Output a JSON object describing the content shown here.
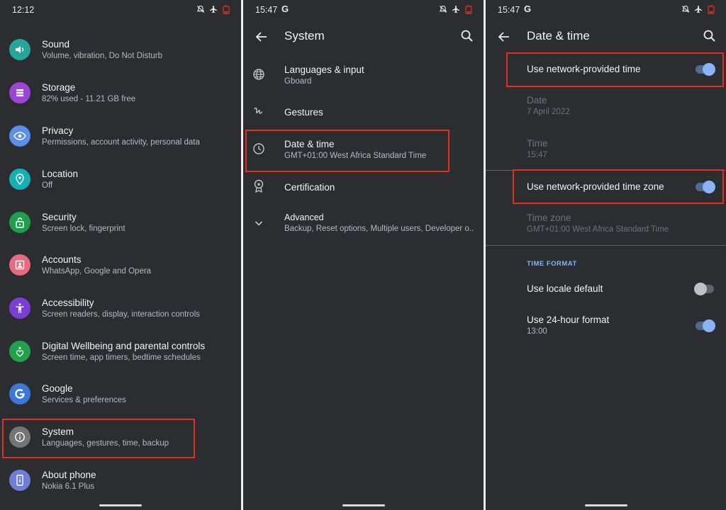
{
  "panel1": {
    "status_time": "12:12",
    "items": [
      {
        "title": "Sound",
        "subtitle": "Volume, vibration, Do Not Disturb",
        "icon": "sound-icon",
        "color": "#26a69a"
      },
      {
        "title": "Storage",
        "subtitle": "82% used - 11.21 GB free",
        "icon": "storage-icon",
        "color": "#9c45d6"
      },
      {
        "title": "Privacy",
        "subtitle": "Permissions, account activity, personal data",
        "icon": "privacy-icon",
        "color": "#5b8fe8"
      },
      {
        "title": "Location",
        "subtitle": "Off",
        "icon": "location-icon",
        "color": "#14b1b4"
      },
      {
        "title": "Security",
        "subtitle": "Screen lock, fingerprint",
        "icon": "security-icon",
        "color": "#1e9e4a"
      },
      {
        "title": "Accounts",
        "subtitle": "WhatsApp, Google and Opera",
        "icon": "accounts-icon",
        "color": "#e86a7e"
      },
      {
        "title": "Accessibility",
        "subtitle": "Screen readers, display, interaction controls",
        "icon": "accessibility-icon",
        "color": "#7b3fd6"
      },
      {
        "title": "Digital Wellbeing and parental controls",
        "subtitle": "Screen time, app timers, bedtime schedules",
        "icon": "wellbeing-icon",
        "color": "#21a24a"
      },
      {
        "title": "Google",
        "subtitle": "Services & preferences",
        "icon": "google-icon",
        "color": "#3c78d8"
      },
      {
        "title": "System",
        "subtitle": "Languages, gestures, time, backup",
        "icon": "info-icon",
        "color": "#757575"
      },
      {
        "title": "About phone",
        "subtitle": "Nokia 6.1 Plus",
        "icon": "phone-icon",
        "color": "#6f7ed8"
      }
    ]
  },
  "panel2": {
    "status_time": "15:47",
    "status_g": "G",
    "title": "System",
    "items": [
      {
        "title": "Languages & input",
        "subtitle": "Gboard",
        "icon": "globe-icon"
      },
      {
        "title": "Gestures",
        "subtitle": "",
        "icon": "gestures-icon"
      },
      {
        "title": "Date & time",
        "subtitle": "GMT+01:00 West Africa Standard Time",
        "icon": "clock-icon"
      },
      {
        "title": "Certification",
        "subtitle": "",
        "icon": "certification-icon"
      },
      {
        "title": "Advanced",
        "subtitle": "Backup, Reset options, Multiple users, Developer o..",
        "icon": "chevron-down-icon"
      }
    ]
  },
  "panel3": {
    "status_time": "15:47",
    "status_g": "G",
    "title": "Date & time",
    "network_time": {
      "label": "Use network-provided time",
      "on": true
    },
    "date": {
      "label": "Date",
      "value": "7 April 2022"
    },
    "time": {
      "label": "Time",
      "value": "15:47"
    },
    "network_zone": {
      "label": "Use network-provided time zone",
      "on": true
    },
    "time_zone": {
      "label": "Time zone",
      "value": "GMT+01:00 West Africa Standard Time"
    },
    "section_label": "TIME FORMAT",
    "locale_default": {
      "label": "Use locale default",
      "on": false
    },
    "hour24": {
      "label": "Use 24-hour format",
      "value": "13:00",
      "on": true
    }
  },
  "colors": {
    "highlight": "#e0301e",
    "accent": "#8ab4f8",
    "background": "#2b2d31"
  }
}
